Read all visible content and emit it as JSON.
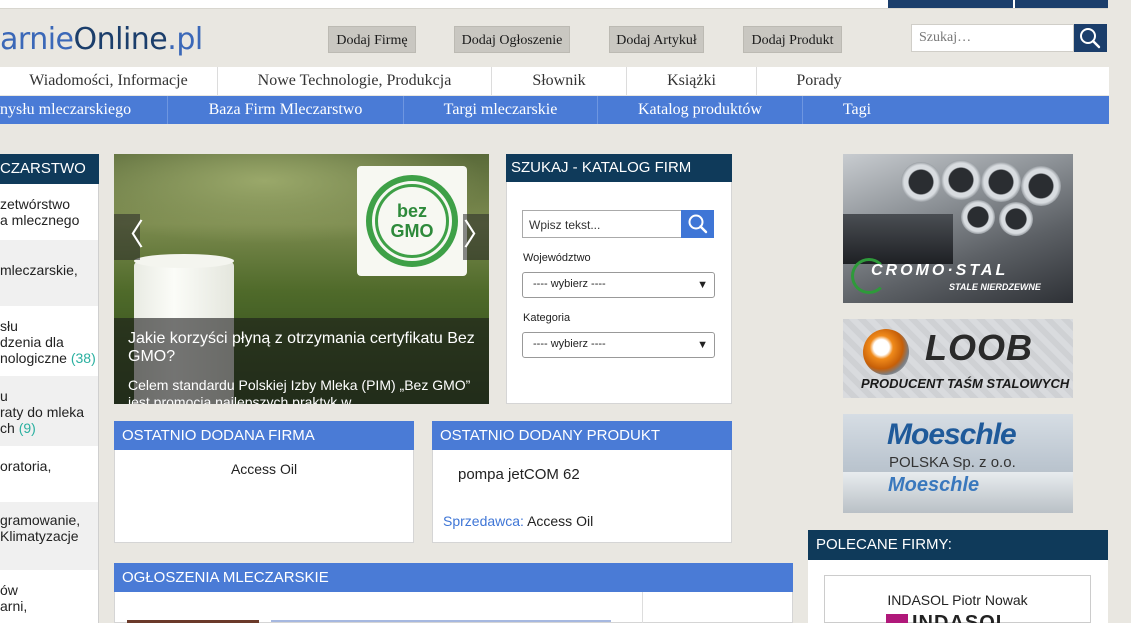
{
  "logo": {
    "part1": "arnie",
    "part2": "Online",
    "part3": ".pl"
  },
  "add_buttons": [
    "Dodaj Firmę",
    "Dodaj Ogłoszenie",
    "Dodaj Artykuł",
    "Dodaj Produkt"
  ],
  "search": {
    "placeholder": "Szukaj…"
  },
  "nav_primary": [
    "Wiadomości, Informacje",
    "Nowe Technologie, Produkcja",
    "Słownik",
    "Książki",
    "Porady"
  ],
  "nav_secondary": [
    "nysłu mleczarskiego",
    "Baza Firm Mleczarstwo",
    "Targi mleczarskie",
    "Katalog produktów",
    "Tagi"
  ],
  "sidebar": {
    "title": "CZARSTWO",
    "items": [
      {
        "lines": [
          "zetwórstwo",
          "a mlecznego"
        ]
      },
      {
        "lines": [
          "mleczarskie,"
        ]
      },
      {
        "lines": [
          "słu",
          "dzenia dla",
          "nologiczne"
        ],
        "count": "(38)"
      },
      {
        "lines": [
          "u",
          "raty do mleka",
          "ch"
        ],
        "count": "(9)"
      },
      {
        "lines": [
          "oratoria,"
        ]
      },
      {
        "lines": [
          "gramowanie,",
          " Klimatyzacje"
        ]
      },
      {
        "lines": [
          "ów",
          "arni,"
        ]
      }
    ]
  },
  "slider": {
    "badge_line1": "bez",
    "badge_line2": "GMO",
    "title": "Jakie korzyści płyną z otrzymania certyfikatu Bez GMO?",
    "description": "Celem standardu Polskiej Izby Mleka (PIM) „Bez GMO” jest promocja najlepszych praktyk w",
    "prev": "〈",
    "next": "〉"
  },
  "katalog": {
    "title": "SZUKAJ - KATALOG FIRM",
    "input_placeholder": "Wpisz tekst...",
    "wojewodztwo_label": "Województwo",
    "kategoria_label": "Kategoria",
    "select_default": "---- wybierz ----"
  },
  "recent_company": {
    "title": "OSTATNIO DODANA FIRMA",
    "name": "Access Oil"
  },
  "recent_product": {
    "title": "OSTATNIO DODANY PRODUKT",
    "name": "pompa jetCOM 62",
    "seller_label": "Sprzedawca:",
    "seller": "Access Oil"
  },
  "ads_section": {
    "title": "OGŁOSZENIA MLECZARSKIE"
  },
  "ads": {
    "cromo_main": "CROMO·STAL",
    "cromo_sub": "STALE NIERDZEWNE",
    "loob_main": "LOOB",
    "loob_sub": "PRODUCENT TAŚM STALOWYCH",
    "moe_main": "Moeschle",
    "moe_sub": "POLSKA Sp. z o.o.",
    "moe_truck": "Moeschle"
  },
  "recommended": {
    "title": "POLECANE FIRMY:",
    "company": "INDASOL Piotr Nowak",
    "logo_text": "INDASOL"
  },
  "colors": {
    "navy": "#0f3a5a",
    "blue": "#4a7bd6",
    "accent_count": "#2ab0a0",
    "link": "#3f76d6"
  }
}
